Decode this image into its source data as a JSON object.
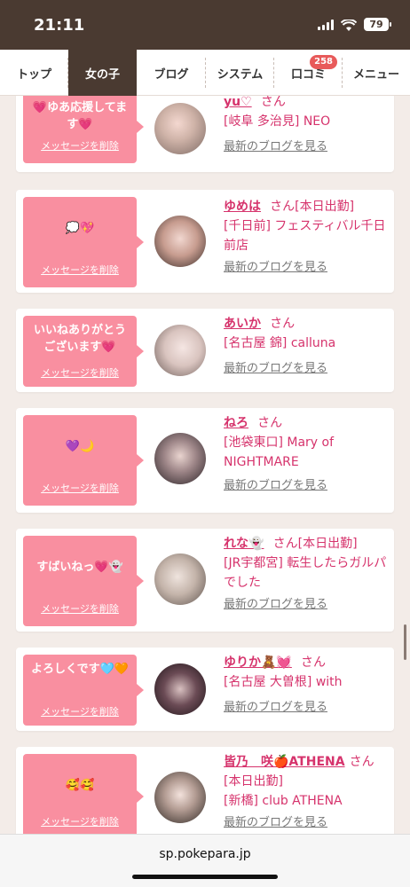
{
  "status": {
    "time": "21:11",
    "battery": "79"
  },
  "nav": {
    "tabs": [
      {
        "label": "トップ"
      },
      {
        "label": "女の子"
      },
      {
        "label": "ブログ"
      },
      {
        "label": "システム"
      },
      {
        "label": "口コミ",
        "badge": "258"
      },
      {
        "label": "メニュー"
      }
    ],
    "active_index": 1
  },
  "common": {
    "delete_label": "メッセージを削除",
    "blog_label": "最新のブログを見る",
    "san": "さん"
  },
  "cards": [
    {
      "message": "💗ゆあ応援してます💗",
      "name": "yu♡",
      "status": "",
      "shop": "[岐阜 多治見] NEO"
    },
    {
      "message": "💭💖",
      "name": "ゆめは",
      "status": "[本日出勤]",
      "shop": "[千日前] フェスティバル千日前店"
    },
    {
      "message": "いいねありがとうございます💗",
      "name": "あいか",
      "status": "",
      "shop": "[名古屋 錦] calluna"
    },
    {
      "message": "💜🌙",
      "name": "ねろ",
      "status": "",
      "shop": "[池袋東口] Mary of NIGHTMARE"
    },
    {
      "message": "すばいねっ💗👻",
      "name": "れな👻",
      "status": "[本日出勤]",
      "shop": "[JR宇都宮] 転生したらガルパでした"
    },
    {
      "message": "よろしくです🩵🧡",
      "name": "ゆりか🧸💓",
      "status": "",
      "shop": "[名古屋 大曽根] with"
    },
    {
      "message": "🥰🥰",
      "name": "皆乃　咲🍎ATHENA",
      "status": "[本日出勤]",
      "shop": "[新橋] club ATHENA"
    }
  ],
  "browser": {
    "url": "sp.pokepara.jp"
  }
}
